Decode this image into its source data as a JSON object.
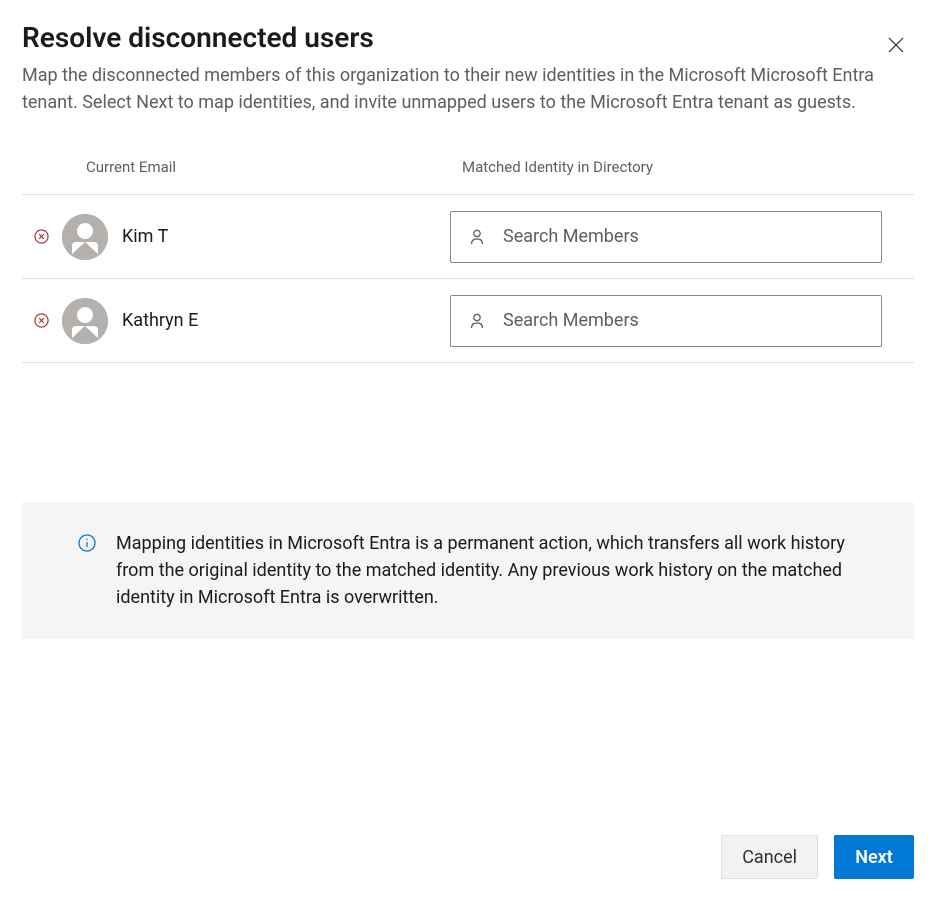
{
  "header": {
    "title": "Resolve disconnected users",
    "subtitle": "Map the disconnected members of this organization to their new identities in the Microsoft Microsoft Entra tenant. Select Next to map identities, and invite unmapped users to the Microsoft Entra tenant as guests."
  },
  "columns": {
    "email": "Current Email",
    "identity": "Matched Identity in Directory"
  },
  "users": [
    {
      "name": "Kim T",
      "search_placeholder": "Search Members"
    },
    {
      "name": "Kathryn E",
      "search_placeholder": "Search Members"
    }
  ],
  "info": {
    "text": "Mapping identities in Microsoft Entra is a permanent action, which transfers all work history from the original identity to the matched identity. Any previous work history on the matched identity in Microsoft Entra is overwritten."
  },
  "footer": {
    "cancel": "Cancel",
    "next": "Next"
  }
}
